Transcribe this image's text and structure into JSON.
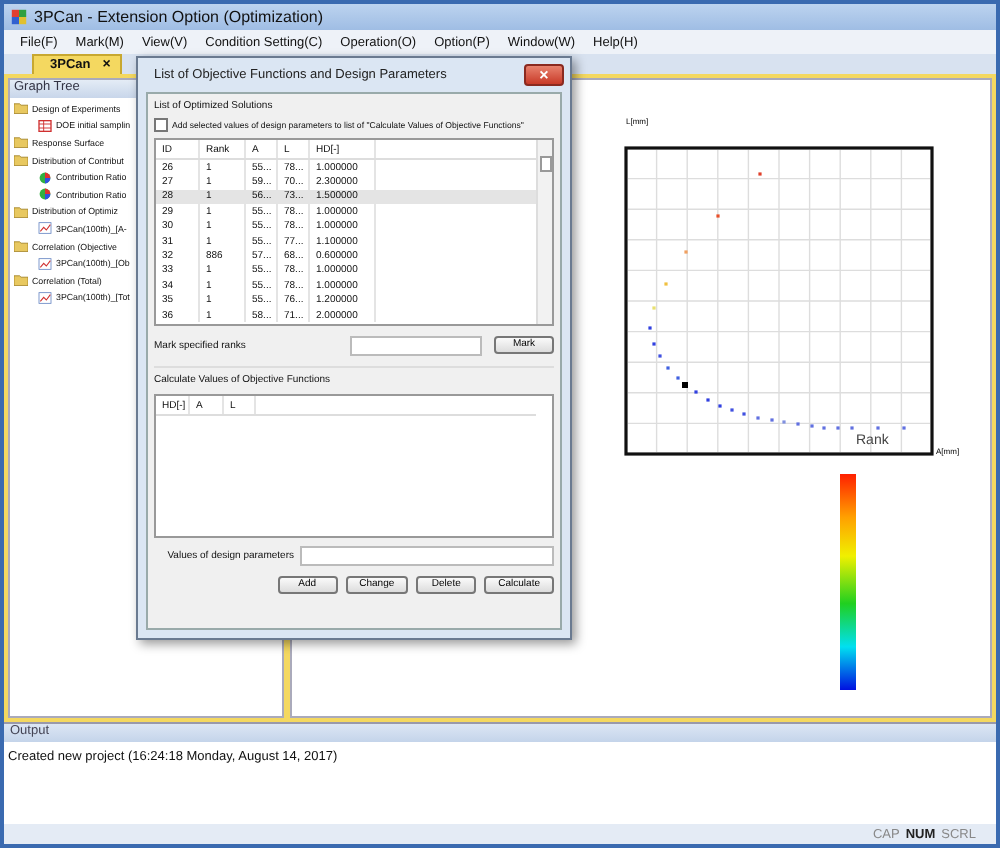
{
  "window": {
    "title": "3PCan - Extension Option (Optimization)"
  },
  "menu": [
    "File(F)",
    "Mark(M)",
    "View(V)",
    "Condition Setting(C)",
    "Operation(O)",
    "Option(P)",
    "Window(W)",
    "Help(H)"
  ],
  "tabs": [
    {
      "label": "3PCan",
      "close": "×"
    }
  ],
  "graph_tree": {
    "title": "Graph Tree",
    "items": [
      {
        "label": "Design of Experiments",
        "kind": "folder",
        "children": [
          {
            "label": "DOE initial samplin",
            "kind": "table"
          }
        ]
      },
      {
        "label": "Response Surface",
        "kind": "folder"
      },
      {
        "label": "Distribution of Contribut",
        "kind": "folder",
        "children": [
          {
            "label": "Contribution Ratio",
            "kind": "pie"
          },
          {
            "label": "Contribution Ratio",
            "kind": "pie"
          }
        ]
      },
      {
        "label": "Distribution of Optimiz",
        "kind": "folder",
        "children": [
          {
            "label": "3PCan(100th)_[A-",
            "kind": "chart"
          }
        ]
      },
      {
        "label": "Correlation (Objective",
        "kind": "folder",
        "children": [
          {
            "label": "3PCan(100th)_[Ob",
            "kind": "chart"
          }
        ]
      },
      {
        "label": "Correlation (Total)",
        "kind": "folder",
        "children": [
          {
            "label": "3PCan(100th)_[Tot",
            "kind": "chart"
          }
        ]
      }
    ]
  },
  "graph": {
    "y_label": "L[mm]",
    "x_label": "A[mm]",
    "legend_label": "Rank"
  },
  "dialog": {
    "title": "List of Objective Functions and Design Parameters",
    "close": "×",
    "solutions_label": "List of Optimized Solutions",
    "add_checkbox": {
      "label": "Add selected values of design parameters to list of \"Calculate Values of Objective Functions\"",
      "checked": false
    },
    "columns": [
      "ID",
      "Rank",
      "A",
      "L",
      "HD[-]"
    ],
    "rows": [
      {
        "cells": [
          "26",
          "1",
          "55...",
          "78...",
          "1.000000"
        ],
        "selected": false
      },
      {
        "cells": [
          "27",
          "1",
          "59...",
          "70...",
          "2.300000"
        ],
        "selected": false
      },
      {
        "cells": [
          "28",
          "1",
          "56...",
          "73...",
          "1.500000"
        ],
        "selected": true
      },
      {
        "cells": [
          "29",
          "1",
          "55...",
          "78...",
          "1.000000"
        ],
        "selected": false
      },
      {
        "cells": [
          "30",
          "1",
          "55...",
          "78...",
          "1.000000"
        ],
        "selected": false
      },
      {
        "cells": [
          "31",
          "1",
          "55...",
          "77...",
          "1.100000"
        ],
        "selected": false
      },
      {
        "cells": [
          "32",
          "886",
          "57...",
          "68...",
          "0.600000"
        ],
        "selected": false
      },
      {
        "cells": [
          "33",
          "1",
          "55...",
          "78...",
          "1.000000"
        ],
        "selected": false
      },
      {
        "cells": [
          "34",
          "1",
          "55...",
          "78...",
          "1.000000"
        ],
        "selected": false
      },
      {
        "cells": [
          "35",
          "1",
          "55...",
          "76...",
          "1.200000"
        ],
        "selected": false
      },
      {
        "cells": [
          "36",
          "1",
          "58...",
          "71...",
          "2.000000"
        ],
        "selected": false
      }
    ],
    "mark_label": "Mark specified ranks",
    "mark_button": "Mark",
    "calc_label": "Calculate Values of Objective Functions",
    "calc_columns": [
      "HD[-]",
      "A",
      "L"
    ],
    "values_label": "Values of design parameters",
    "buttons": [
      "Add",
      "Change",
      "Delete",
      "Calculate"
    ]
  },
  "output": {
    "title": "Output",
    "lines": [
      "Created new project (16:24:18 Monday, August 14, 2017)"
    ]
  },
  "status_bar": [
    {
      "label": "CAP",
      "on": false
    },
    {
      "label": "NUM",
      "on": true
    },
    {
      "label": "SCRL",
      "on": false
    }
  ]
}
